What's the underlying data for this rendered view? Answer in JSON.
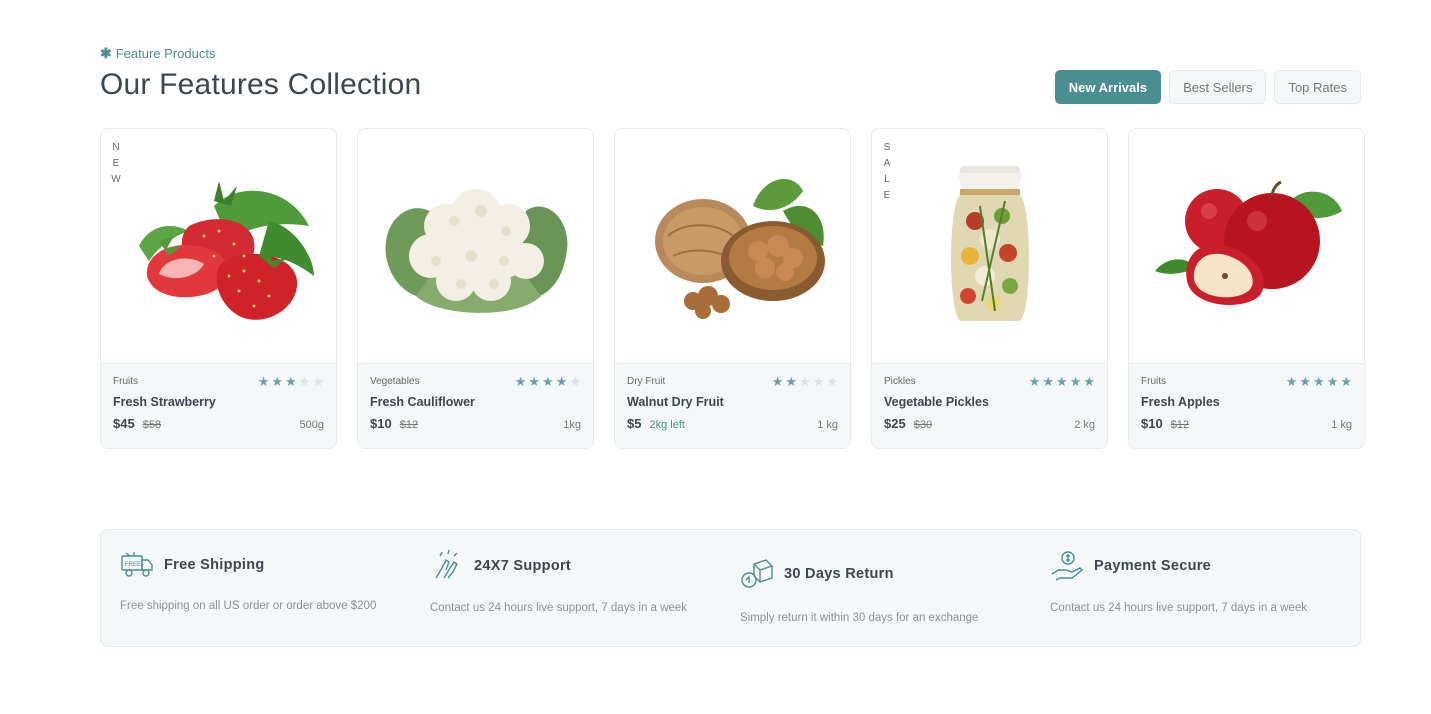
{
  "header": {
    "kicker": "Feature Products",
    "title": "Our Features Collection"
  },
  "filters": [
    {
      "label": "New Arrivals",
      "active": true
    },
    {
      "label": "Best Sellers",
      "active": false
    },
    {
      "label": "Top Rates",
      "active": false
    }
  ],
  "products": [
    {
      "category": "Fruits",
      "name": "Fresh Strawberry",
      "price": "$45",
      "old_price": "$58",
      "weight": "500g",
      "rating": 3,
      "badge": "NEW",
      "image": "strawberry-image"
    },
    {
      "category": "Vegetables",
      "name": "Fresh Cauliflower",
      "price": "$10",
      "old_price": "$12",
      "weight": "1kg",
      "rating": 4,
      "image": "cauliflower-image"
    },
    {
      "category": "Dry Fruit",
      "name": "Walnut Dry Fruit",
      "price": "$5",
      "stock_left": "2kg left",
      "weight": "1 kg",
      "rating": 2,
      "image": "walnut-image"
    },
    {
      "category": "Pickles",
      "name": "Vegetable Pickles",
      "price": "$25",
      "old_price": "$30",
      "weight": "2 kg",
      "rating": 5,
      "badge": "SALE",
      "image": "pickle-jar-image"
    },
    {
      "category": "Fruits",
      "name": "Fresh Apples",
      "price": "$10",
      "old_price": "$12",
      "weight": "1 kg",
      "rating": 5,
      "image": "apple-image"
    }
  ],
  "services": [
    {
      "title": "Free Shipping",
      "text": "Free shipping on all US order or order above $200",
      "icon": "free-shipping-truck-icon"
    },
    {
      "title": "24X7 Support",
      "text": "Contact us 24 hours live support, 7 days in a week",
      "icon": "support-hands-icon"
    },
    {
      "title": "30 Days Return",
      "text": "Simply return it within 30 days for an exchange",
      "icon": "return-box-icon"
    },
    {
      "title": "Payment Secure",
      "text": "Contact us 24 hours live support, 7 days in a week",
      "icon": "secure-payment-icon"
    }
  ],
  "colors": {
    "accent": "#4b8e91",
    "star": "#6f9fa4",
    "panel": "#f4f8f9"
  }
}
